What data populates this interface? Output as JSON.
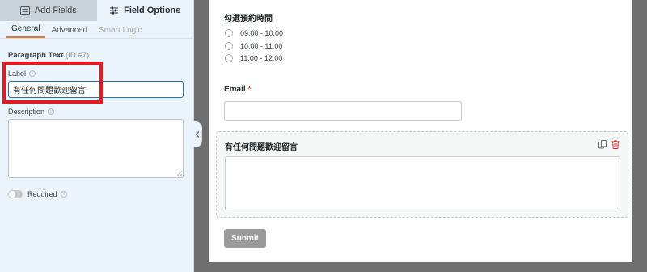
{
  "tabs": {
    "add_fields": "Add Fields",
    "field_options": "Field Options"
  },
  "sub_tabs": [
    "General",
    "Advanced",
    "Smart Logic"
  ],
  "field": {
    "heading": "Paragraph Text",
    "id_text": "(ID #7)",
    "label_label": "Label",
    "label_value": "有任何問題歡迎留言",
    "description_label": "Description",
    "required_label": "Required",
    "required_on": false
  },
  "form": {
    "time_label": "勾選預約時間",
    "time_options": [
      "09:00 - 10:00",
      "10:00 - 11:00",
      "11:00 - 12:00"
    ],
    "email_label": "Email",
    "required_marker": "*",
    "paragraph_label": "有任何問題歡迎留言",
    "submit_label": "Submit"
  },
  "colors": {
    "accent_orange": "#e27730",
    "highlight_red": "#e01b24",
    "panel_bg": "#ebf3fb",
    "submit_gray": "#9a9a9a"
  },
  "icons": {
    "add_fields": "list-icon",
    "field_options": "sliders-icon",
    "help": "help-circle-icon",
    "collapse": "chevron-left-icon",
    "duplicate": "copy-icon",
    "delete": "trash-icon"
  }
}
